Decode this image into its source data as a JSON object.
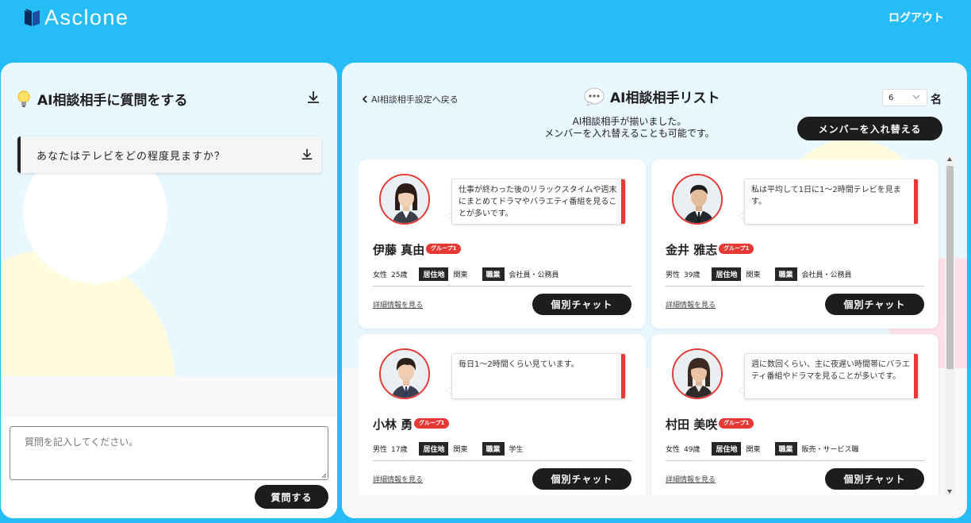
{
  "header": {
    "logo_text": "Asclone",
    "logout_label": "ログアウト",
    "bg_color": "#26bdf6"
  },
  "left_panel": {
    "title": "AI相談相手に質問をする",
    "question_text": "あなたはテレビをどの程度見ますか？",
    "input_placeholder": "質問を記入してください。",
    "ask_button_label": "質問する"
  },
  "right_panel": {
    "back_link_label": "AI相談相手設定へ戻る",
    "title": "AI相談相手リスト",
    "description_line1": "AI相談相手が揃いました。",
    "description_line2": "メンバーを入れ替えることも可能です。",
    "member_count": "6",
    "member_count_unit": "名",
    "swap_button_label": "メンバーを入れ替える",
    "residence_tag": "居住地",
    "occupation_tag": "職業",
    "detail_link_label": "詳細情報を見る",
    "chat_button_label": "個別チャット",
    "accent_color": "#e53935",
    "members": [
      {
        "name": "伊藤 真由",
        "group": "グループ1",
        "gender": "女性",
        "age": "25歳",
        "residence": "関東",
        "occupation": "会社員・公務員",
        "answer": "仕事が終わった後のリラックスタイムや週末にまとめてドラマやバラエティ番組を見ることが多いです。"
      },
      {
        "name": "金井 雅志",
        "group": "グループ1",
        "gender": "男性",
        "age": "39歳",
        "residence": "関東",
        "occupation": "会社員・公務員",
        "answer": "私は平均して1日に1〜2時間テレビを見ます。"
      },
      {
        "name": "小林 勇",
        "group": "グループ1",
        "gender": "男性",
        "age": "17歳",
        "residence": "関東",
        "occupation": "学生",
        "answer": "毎日1〜2時間くらい見ています。"
      },
      {
        "name": "村田 美咲",
        "group": "グループ1",
        "gender": "女性",
        "age": "49歳",
        "residence": "関東",
        "occupation": "販売・サービス職",
        "answer": "週に数回くらい、主に夜遅い時間帯にバラエティ番組やドラマを見ることが多いです。"
      }
    ]
  }
}
